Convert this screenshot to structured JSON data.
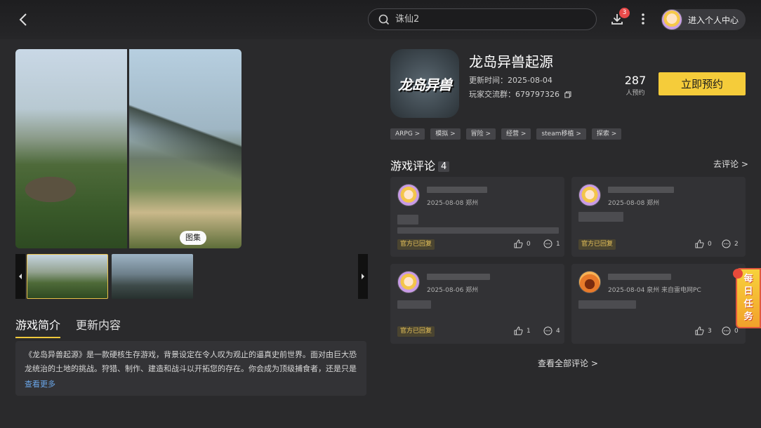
{
  "header": {
    "search_placeholder": "诛仙2",
    "download_badge": "3",
    "profile_label": "进入个人中心"
  },
  "gallery": {
    "label": "图集"
  },
  "tabs": [
    {
      "label": "游戏简介",
      "active": true
    },
    {
      "label": "更新内容",
      "active": false
    }
  ],
  "description": {
    "text": "《龙岛异兽起源》是一款硬核生存游戏，背景设定在令人叹为观止的逼真史前世界。面对由巨大恐龙统治的土地的挑战。狩猎、制作、建造和战斗以开拓您的存在。你会成为顶级捕食者，还是只是另...",
    "more": "查看更多"
  },
  "game": {
    "title": "龙岛异兽起源",
    "icon_text": "龙岛异兽",
    "update_time": "更新时间：2025-08-04",
    "player_group": "玩家交流群：679797326",
    "reserve_count": "287",
    "reserve_label": "人预约",
    "reserve_button": "立即预约"
  },
  "tags": [
    "ARPG >",
    "模拟 >",
    "冒险 >",
    "经营 >",
    "steam移植 >",
    "探索 >"
  ],
  "reviews": {
    "title": "游戏评论",
    "count": "4",
    "go_review": "去评论 >",
    "all_reviews": "查看全部评论 >",
    "items": [
      {
        "meta": "2025-08-08 郑州",
        "official": "官方已回复",
        "likes": "0",
        "comments": "1"
      },
      {
        "meta": "2025-08-08 郑州",
        "official": "官方已回复",
        "likes": "0",
        "comments": "2"
      },
      {
        "meta": "2025-08-06 郑州",
        "official": "官方已回复",
        "likes": "1",
        "comments": "4"
      },
      {
        "meta": "2025-08-04 泉州 来自雷电网PC",
        "official": "",
        "likes": "3",
        "comments": "0"
      }
    ]
  },
  "daily_task": [
    "每",
    "日",
    "任",
    "务"
  ],
  "colors": {
    "accent": "#f5cc3a",
    "background": "#2a2a2c",
    "badge": "#e84a4a",
    "link": "#6aa6e8"
  }
}
